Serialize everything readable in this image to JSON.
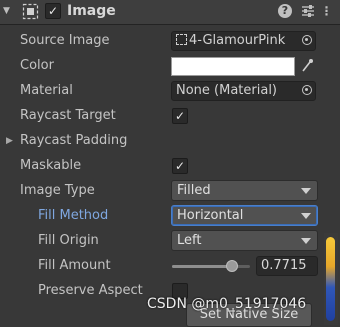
{
  "component": {
    "title": "Image",
    "enabled_mark": "✓"
  },
  "properties": {
    "source_image": {
      "label": "Source Image",
      "value": "4-GlamourPink"
    },
    "color": {
      "label": "Color",
      "swatch": "#ffffff"
    },
    "material": {
      "label": "Material",
      "value": "None (Material)"
    },
    "raycast_target": {
      "label": "Raycast Target",
      "checked_mark": "✓"
    },
    "raycast_padding": {
      "label": "Raycast Padding"
    },
    "maskable": {
      "label": "Maskable",
      "checked_mark": "✓"
    },
    "image_type": {
      "label": "Image Type",
      "value": "Filled"
    },
    "fill_method": {
      "label": "Fill Method",
      "value": "Horizontal"
    },
    "fill_origin": {
      "label": "Fill Origin",
      "value": "Left"
    },
    "fill_amount": {
      "label": "Fill Amount",
      "value": 0.7715,
      "display": "0.7715"
    },
    "preserve_aspect": {
      "label": "Preserve Aspect",
      "checked": false
    }
  },
  "buttons": {
    "set_native_size": "Set Native Size"
  },
  "watermark": "CSDN @m0_51917046",
  "colors": {
    "background": "#383838",
    "active_label": "#7fa7e0",
    "focus_border": "#4a7fc9"
  }
}
